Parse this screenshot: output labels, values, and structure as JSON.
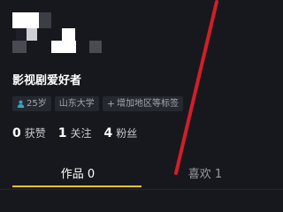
{
  "profile": {
    "display_name": "影视剧爱好者",
    "tags": {
      "age": "25岁",
      "school": "山东大学",
      "add_region": "增加地区等标签"
    }
  },
  "stats": {
    "likes_count": "0",
    "likes_label": "获赞",
    "following_count": "1",
    "following_label": "关注",
    "followers_count": "4",
    "followers_label": "粉丝"
  },
  "tabs": {
    "works": "作品 0",
    "liked": "喜欢 1"
  },
  "colors": {
    "background": "#17181e",
    "accent": "#f1c232",
    "annotation_red": "#d11f28",
    "age_icon": "#37a3c6"
  },
  "icons": {
    "age": "person-icon",
    "add": "plus-icon"
  }
}
